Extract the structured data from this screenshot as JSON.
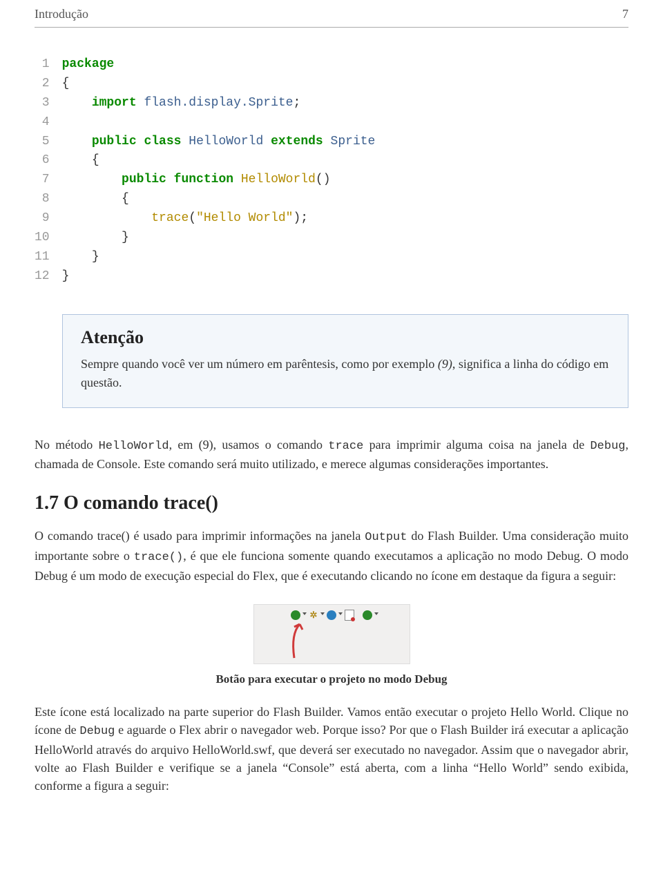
{
  "header": {
    "title": "Introdução",
    "page": "7"
  },
  "code": {
    "lines": [
      {
        "n": "1",
        "t": [
          [
            "kw",
            "package"
          ]
        ]
      },
      {
        "n": "2",
        "t": [
          [
            "plain",
            "{"
          ]
        ]
      },
      {
        "n": "3",
        "t": [
          [
            "plain",
            "    "
          ],
          [
            "kw",
            "import"
          ],
          [
            "plain",
            " "
          ],
          [
            "cls",
            "flash.display.Sprite"
          ],
          [
            "plain",
            ";"
          ]
        ]
      },
      {
        "n": "4",
        "t": [
          [
            "plain",
            ""
          ]
        ]
      },
      {
        "n": "5",
        "t": [
          [
            "plain",
            "    "
          ],
          [
            "kw",
            "public class"
          ],
          [
            "plain",
            " "
          ],
          [
            "cls",
            "HelloWorld"
          ],
          [
            "plain",
            " "
          ],
          [
            "kw",
            "extends"
          ],
          [
            "plain",
            " "
          ],
          [
            "cls",
            "Sprite"
          ]
        ]
      },
      {
        "n": "6",
        "t": [
          [
            "plain",
            "    {"
          ]
        ]
      },
      {
        "n": "7",
        "t": [
          [
            "plain",
            "        "
          ],
          [
            "kw",
            "public function"
          ],
          [
            "plain",
            " "
          ],
          [
            "fn",
            "HelloWorld"
          ],
          [
            "plain",
            "()"
          ]
        ]
      },
      {
        "n": "8",
        "t": [
          [
            "plain",
            "        {"
          ]
        ]
      },
      {
        "n": "9",
        "t": [
          [
            "plain",
            "            "
          ],
          [
            "fn",
            "trace"
          ],
          [
            "plain",
            "("
          ],
          [
            "str",
            "\"Hello World\""
          ],
          [
            "plain",
            ");"
          ]
        ]
      },
      {
        "n": "10",
        "t": [
          [
            "plain",
            "        }"
          ]
        ]
      },
      {
        "n": "11",
        "t": [
          [
            "plain",
            "    }"
          ]
        ]
      },
      {
        "n": "12",
        "t": [
          [
            "plain",
            "}"
          ]
        ]
      }
    ]
  },
  "note": {
    "title": "Atenção",
    "body_pre": "Sempre quando você ver um número em parêntesis, como por exemplo ",
    "body_em": "(9)",
    "body_post": ", significa a linha do código em questão."
  },
  "para1": {
    "a": "No método ",
    "m1": "HelloWorld",
    "b": ", em (9), usamos o comando ",
    "m2": "trace",
    "c": " para imprimir alguma coisa na janela de ",
    "m3": "Debug",
    "d": ", chamada de Console. Este comando será muito utilizado, e merece algumas considerações importantes."
  },
  "section": {
    "heading": "1.7 O comando trace()"
  },
  "para2": {
    "a": "O comando trace() é usado para imprimir informações na janela ",
    "m1": "Output",
    "b": " do Flash Builder. Uma consideração muito importante sobre o ",
    "m2": "trace()",
    "c": ", é que ele funciona somente quando executamos a aplicação no modo Debug. O modo Debug é um modo de execução especial do Flex, que é executando clicando no ícone em destaque da figura a seguir:"
  },
  "toolbar_icons": {
    "run": "run-icon",
    "debug": "debug-icon",
    "external": "external-tools-icon",
    "export": "export-icon",
    "profile": "profile-icon"
  },
  "caption": "Botão para executar o projeto no modo Debug",
  "para3": {
    "a": "Este ícone está localizado na parte superior do Flash Builder. Vamos então executar o projeto Hello World. Clique no ícone de ",
    "m1": "Debug",
    "b": " e aguarde o Flex abrir o navegador web. Porque isso? Por que o Flash Builder irá executar a aplicação HelloWorld através do arquivo HelloWorld.swf, que deverá ser executado no navegador. Assim que o navegador abrir, volte ao Flash Builder e verifique se a janela “Console” está aberta, com a linha “Hello World” sendo exibida, conforme a figura a seguir:"
  }
}
